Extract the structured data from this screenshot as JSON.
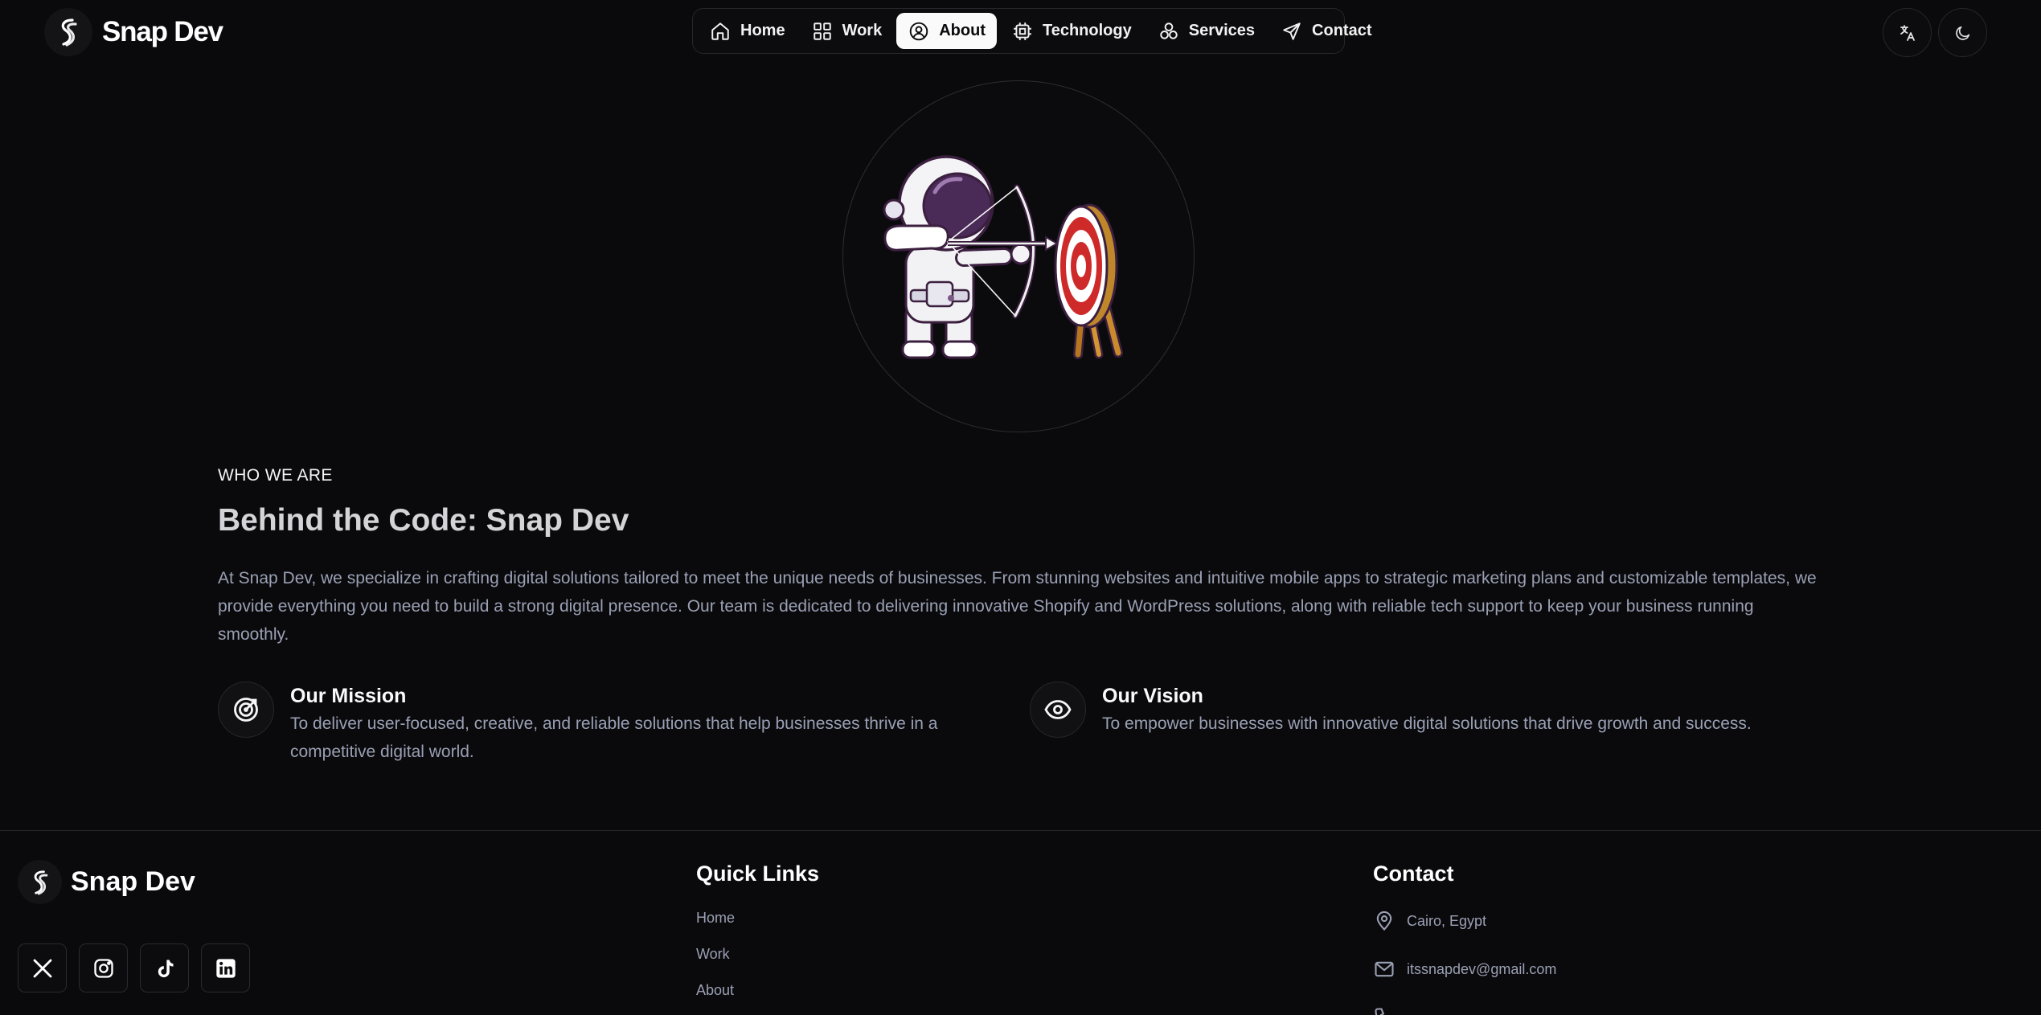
{
  "header": {
    "brand": "Snap Dev",
    "nav": [
      {
        "label": "Home",
        "icon": "home-icon"
      },
      {
        "label": "Work",
        "icon": "grid-icon"
      },
      {
        "label": "About",
        "icon": "user-circle-icon",
        "active": true
      },
      {
        "label": "Technology",
        "icon": "chip-icon"
      },
      {
        "label": "Services",
        "icon": "services-icon"
      },
      {
        "label": "Contact",
        "icon": "send-icon"
      }
    ]
  },
  "hero": {
    "image": "astronaut-archer-illustration"
  },
  "about": {
    "eyebrow": "WHO WE ARE",
    "title": "Behind the Code: Snap Dev",
    "paragraph": "At Snap Dev, we specialize in crafting digital solutions tailored to meet the unique needs of businesses. From stunning websites and intuitive mobile apps to strategic marketing plans and customizable templates, we provide everything you need to build a strong digital presence. Our team is dedicated to delivering innovative Shopify and WordPress solutions, along with reliable tech support to keep your business running smoothly.",
    "mission": {
      "title": "Our Mission",
      "desc": "To deliver user-focused, creative, and reliable solutions that help businesses thrive in a competitive digital world."
    },
    "vision": {
      "title": "Our Vision",
      "desc": "To empower businesses with innovative digital solutions that drive growth and success."
    }
  },
  "footer": {
    "brand": "Snap Dev",
    "quick_links_title": "Quick Links",
    "quick_links": [
      "Home",
      "Work",
      "About"
    ],
    "contact_title": "Contact",
    "location": "Cairo, Egypt",
    "email": "itssnapdev@gmail.com"
  },
  "colors": {
    "background": "#0a0a0c",
    "text": "#fafafa",
    "muted": "#9aa0b4",
    "border": "#26262b"
  }
}
